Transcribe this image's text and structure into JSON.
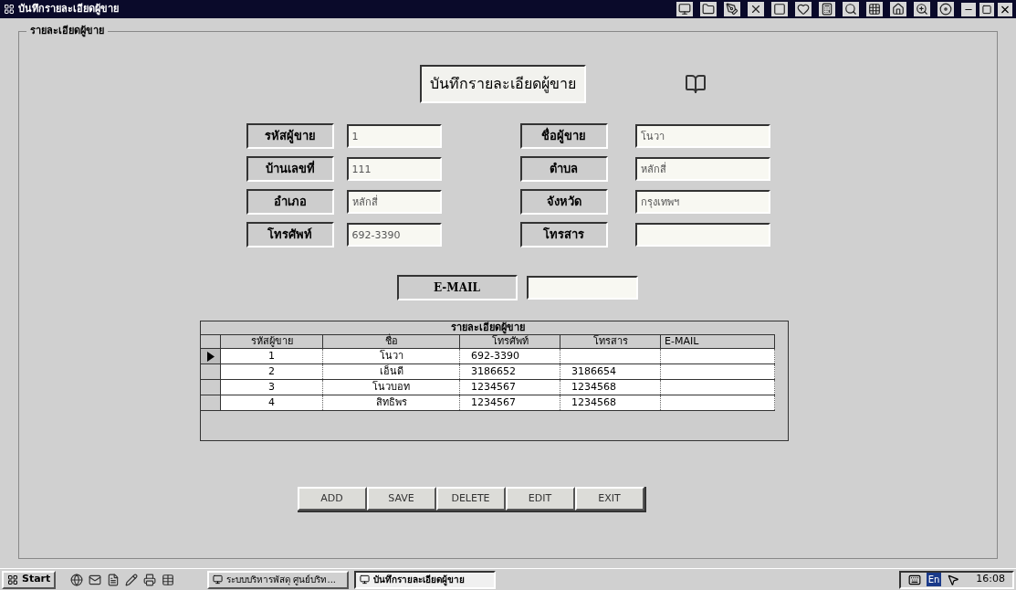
{
  "window": {
    "title": "บันทึกรายละเอียดผู้ขาย"
  },
  "group_label": "รายละเอียดผู้ขาย",
  "header": {
    "title": "บันทึกรายละเอียดผู้ขาย"
  },
  "field_rows": [
    [
      {
        "label": "รหัสผู้ขาย",
        "value": "1"
      },
      {
        "label": "ชื่อผู้ขาย",
        "value": "โนวา"
      }
    ],
    [
      {
        "label": "บ้านเลขที่",
        "value": "111"
      },
      {
        "label": "ตำบล",
        "value": "หลักสี่"
      }
    ],
    [
      {
        "label": "อำเภอ",
        "value": "หลักสี่"
      },
      {
        "label": "จังหวัด",
        "value": "กรุงเทพฯ"
      }
    ],
    [
      {
        "label": "โทรศัพท์",
        "value": "692-3390"
      },
      {
        "label": "โทรสาร"
      }
    ]
  ],
  "email_field": {
    "label": "E-MAIL"
  },
  "grid": {
    "caption": "รายละเอียดผู้ขาย",
    "columns": [
      "รหัสผู้ขาย",
      "ชื่อ",
      "โทรศัพท์",
      "โทรสาร",
      "E-MAIL"
    ],
    "rows": [
      {
        "selected": true,
        "cells": [
          "1",
          "โนวา",
          "692-3390",
          "",
          ""
        ]
      },
      {
        "selected": false,
        "cells": [
          "2",
          "เอ็นดี",
          "3186652",
          "3186654",
          ""
        ]
      },
      {
        "selected": false,
        "cells": [
          "3",
          "โนวบอท",
          "1234567",
          "1234568",
          ""
        ]
      },
      {
        "selected": false,
        "cells": [
          "4",
          "สิทธิพร",
          "1234567",
          "1234568",
          ""
        ]
      }
    ]
  },
  "buttons": [
    "ADD",
    "SAVE",
    "DELETE",
    "EDIT",
    "EXIT"
  ],
  "taskbar": {
    "start": "Start",
    "tasks": [
      {
        "label": "ระบบบริหารพัสดุ ศูนย์บริท...",
        "selected": false
      },
      {
        "label": "บันทึกรายละเอียดผู้ขาย",
        "selected": true
      }
    ],
    "language": "En",
    "clock": "16:08"
  }
}
